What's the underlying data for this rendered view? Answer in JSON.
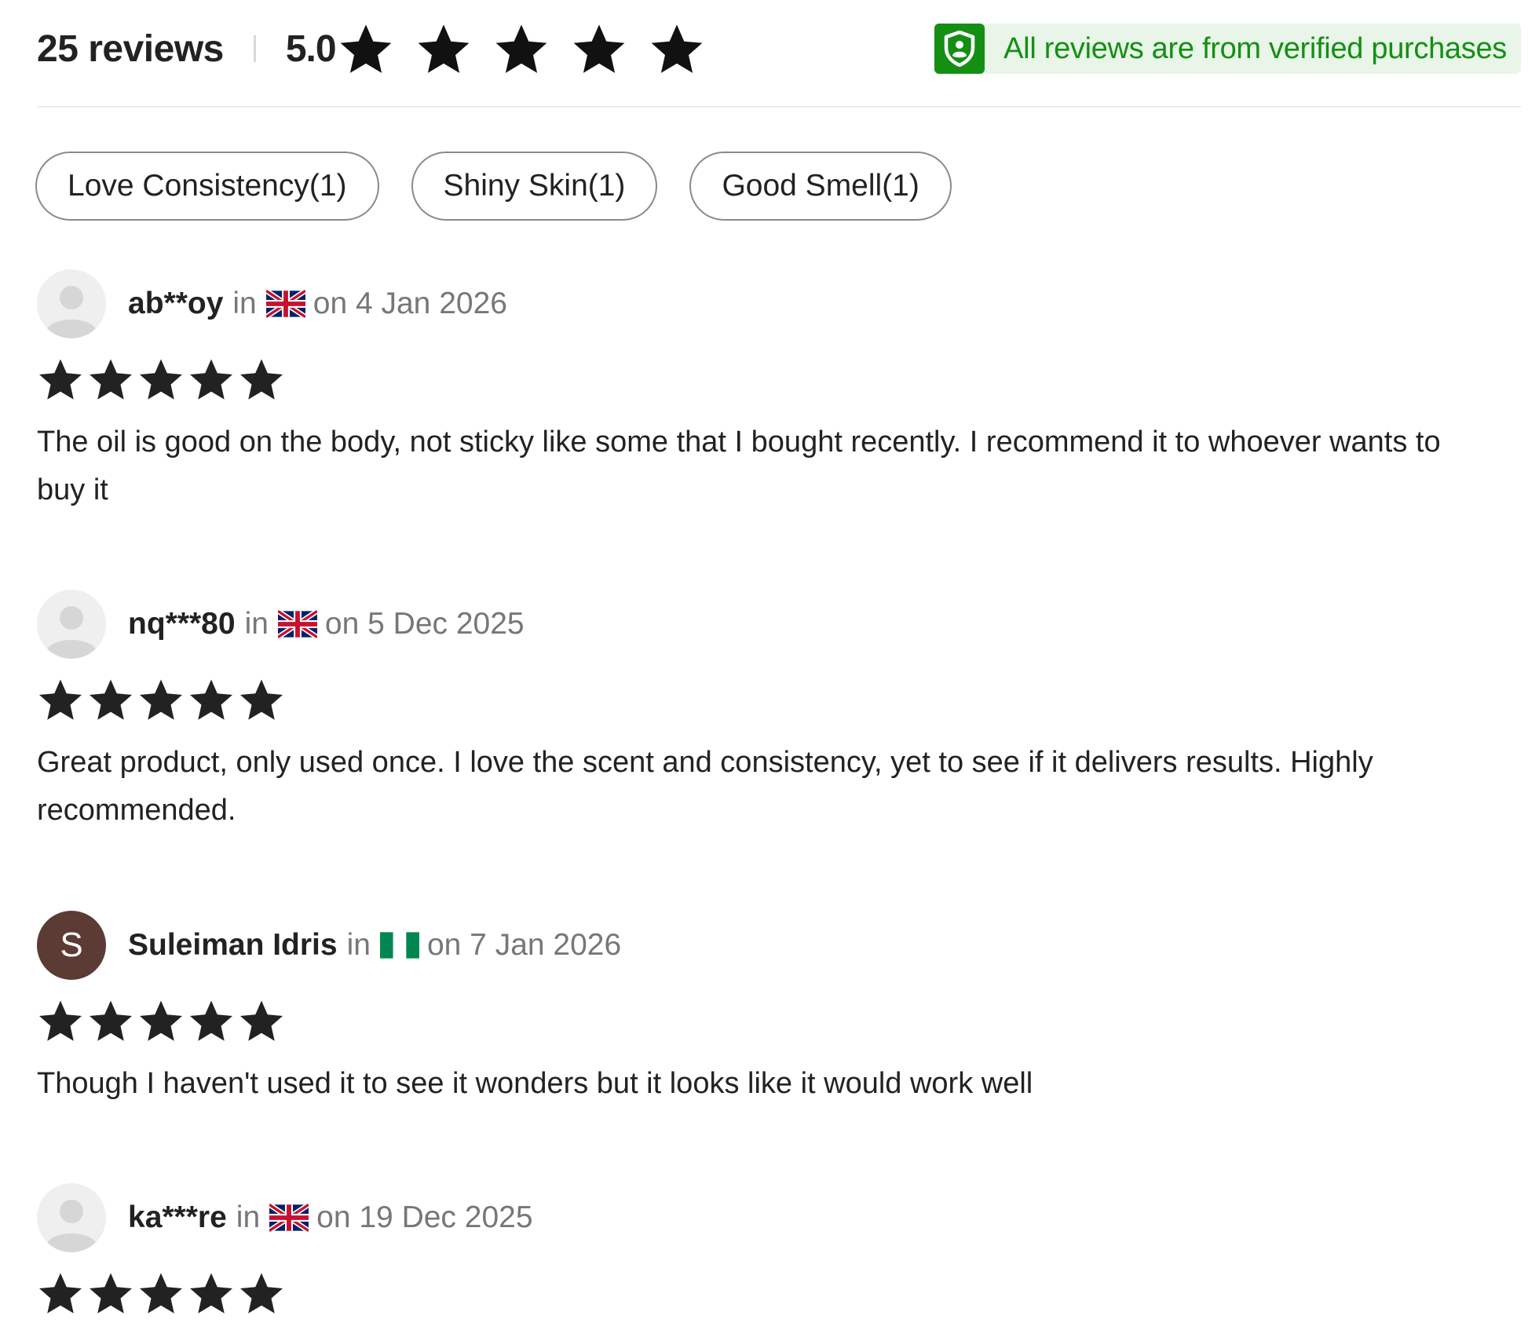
{
  "summary": {
    "review_count": "25 reviews",
    "average": "5.0",
    "rating_stars": 5,
    "verified_text": "All reviews are from verified purchases",
    "icon": "shield-icon",
    "verified_color": "#148f14"
  },
  "tags": [
    {
      "label": "Love Consistency(1)"
    },
    {
      "label": "Shiny Skin(1)"
    },
    {
      "label": "Good Smell(1)"
    }
  ],
  "reviews": [
    {
      "user": "ab**oy",
      "in_word": "in",
      "flag": "uk-flag-icon",
      "date": "on 4 Jan 2026",
      "avatar": "default-avatar-icon",
      "rating": 5,
      "text": "The oil is good on the body, not sticky like some that I bought recently. I recommend it to whoever wants to buy it"
    },
    {
      "user": "nq***80",
      "in_word": "in",
      "flag": "uk-flag-icon",
      "date": "on 5 Dec 2025",
      "avatar": "default-avatar-icon",
      "rating": 5,
      "text": "Great product, only used once. I love the scent and consistency, yet to see if it delivers results. Highly recommended."
    },
    {
      "user": "Suleiman Idris",
      "in_word": "in",
      "flag": "nigeria-flag-icon",
      "date": "on 7 Jan 2026",
      "avatar_letter": "S",
      "avatar_color": "#5b3b33",
      "rating": 5,
      "text": "Though I haven't used it to see it wonders but it looks like it would work well"
    },
    {
      "user": "ka***re",
      "in_word": "in",
      "flag": "uk-flag-icon",
      "date": "on 19 Dec 2025",
      "avatar": "default-avatar-icon",
      "rating": 5,
      "text": ""
    }
  ]
}
